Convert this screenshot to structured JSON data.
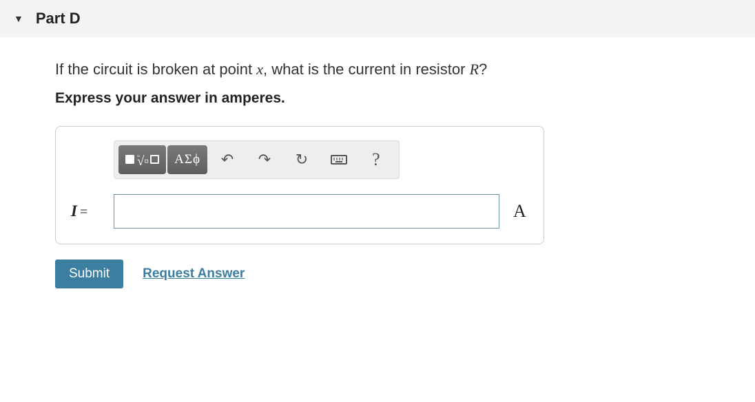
{
  "header": {
    "part_label": "Part D"
  },
  "question": {
    "prefix": "If the circuit is broken at point ",
    "var1": "x",
    "mid": ", what is the current in resistor ",
    "var2": "R",
    "suffix": "?"
  },
  "instruction": "Express your answer in amperes.",
  "toolbar": {
    "greek_label": "ΑΣϕ",
    "help_label": "?"
  },
  "input": {
    "variable": "I",
    "equals": "=",
    "value": "",
    "unit": "A"
  },
  "actions": {
    "submit": "Submit",
    "request": "Request Answer"
  }
}
